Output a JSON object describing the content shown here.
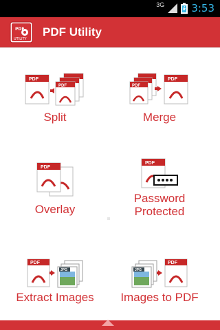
{
  "status_bar": {
    "network": "3G",
    "time": "3:53"
  },
  "app_bar": {
    "title": "PDF Utility",
    "logo_text_top": "PDF",
    "logo_text_bottom": "UTILITY"
  },
  "tiles": [
    {
      "label": "Split"
    },
    {
      "label": "Merge"
    },
    {
      "label": "Overlay"
    },
    {
      "label_line1": "Password",
      "label_line2": "Protected"
    },
    {
      "label": "Extract Images"
    },
    {
      "label": "Images to PDF"
    }
  ],
  "icon_texts": {
    "pdf": "PDF",
    "jpg": "JPG"
  },
  "colors": {
    "accent": "#d23236",
    "time": "#33b5e5"
  }
}
